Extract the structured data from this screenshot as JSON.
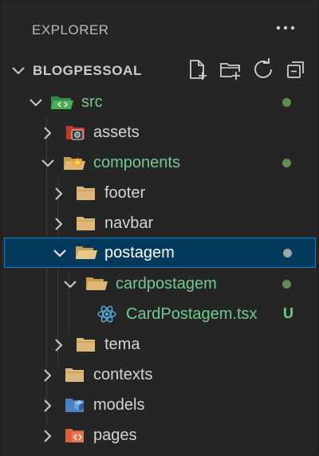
{
  "header": {
    "title": "EXPLORER"
  },
  "section": {
    "title": "BLOGPESSOAL",
    "actions": [
      "new-file-icon",
      "new-folder-icon",
      "refresh-icon",
      "collapse-all-icon"
    ]
  },
  "tree": {
    "src": "src",
    "assets": "assets",
    "components": "components",
    "footer": "footer",
    "navbar": "navbar",
    "postagem": "postagem",
    "cardpostagem": "cardpostagem",
    "cardpostagem_file": "CardPostagem.tsx",
    "cardpostagem_file_status": "U",
    "tema": "tema",
    "contexts": "contexts",
    "models": "models",
    "pages": "pages"
  },
  "colors": {
    "background": "#252526",
    "selected_bg": "#04395e",
    "selected_border": "#0a7ed1",
    "untracked_green": "#73c991",
    "folder": "#dcb67a"
  }
}
